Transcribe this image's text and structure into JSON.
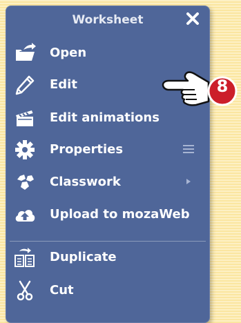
{
  "menu": {
    "title": "Worksheet",
    "items": [
      {
        "label": "Open",
        "icon": "folder-open-icon"
      },
      {
        "label": "Edit",
        "icon": "pencil-icon"
      },
      {
        "label": "Edit animations",
        "icon": "clapperboard-icon"
      },
      {
        "label": "Properties",
        "icon": "gear-icon",
        "trail_icon": "hamburger-icon"
      },
      {
        "label": "Classwork",
        "icon": "classwork-icon",
        "trail_icon": "submenu-arrow-icon"
      },
      {
        "label": "Upload to mozaWeb",
        "icon": "cloud-upload-icon"
      },
      {
        "label": "Duplicate",
        "icon": "duplicate-icon"
      },
      {
        "label": "Cut",
        "icon": "scissors-icon"
      }
    ]
  },
  "annotation": {
    "badge": "8",
    "icon": "pointing-hand-icon"
  },
  "colors": {
    "menu_bg": "#4f6699",
    "badge": "#cc1e2a",
    "page_bg": "#fce9a8"
  }
}
